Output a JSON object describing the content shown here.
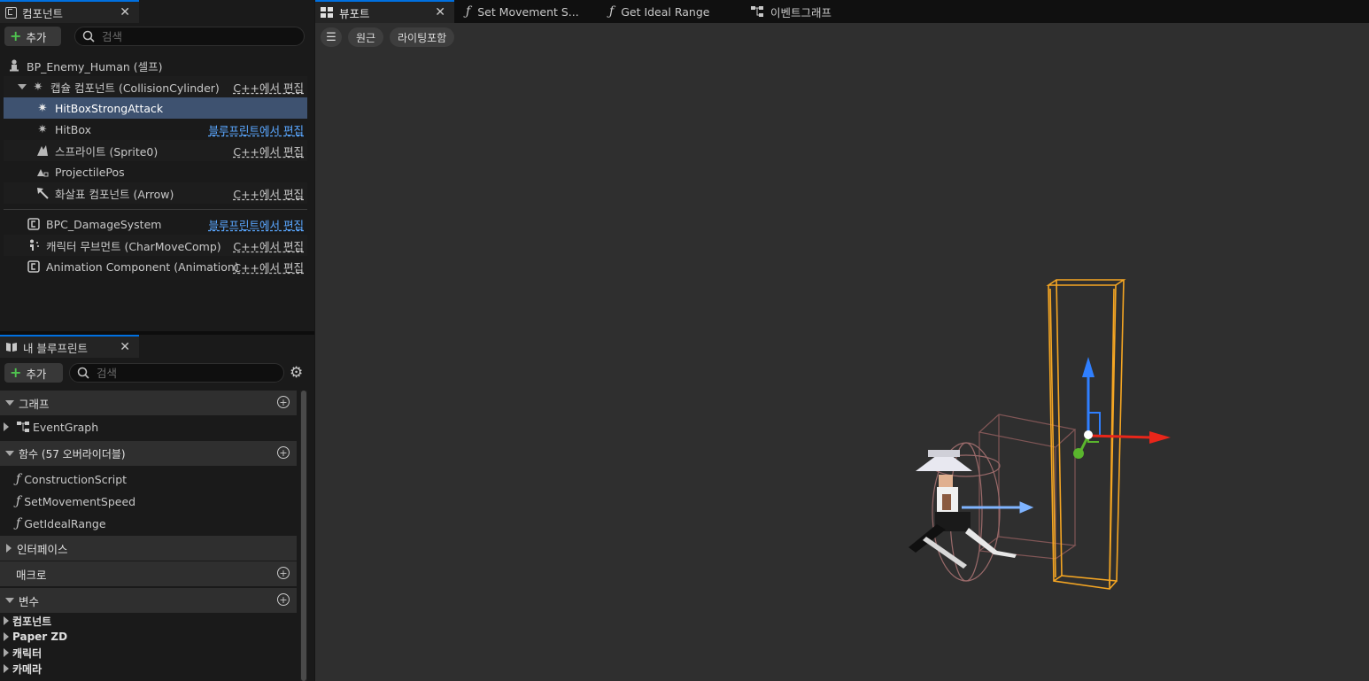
{
  "components_panel": {
    "tab_label": "컴포넌트",
    "add_label": "추가",
    "search_placeholder": "검색",
    "items": [
      {
        "label": "BP_Enemy_Human (셀프)",
        "action": ""
      },
      {
        "label": "캡슐 컴포넌트 (CollisionCylinder)",
        "action": "C++에서 편집"
      },
      {
        "label": "HitBoxStrongAttack",
        "action": ""
      },
      {
        "label": "HitBox",
        "action": "블루프린트에서 편집"
      },
      {
        "label": "스프라이트 (Sprite0)",
        "action": "C++에서 편집"
      },
      {
        "label": "ProjectilePos",
        "action": ""
      },
      {
        "label": "화살표 컴포넌트 (Arrow)",
        "action": "C++에서 편집"
      },
      {
        "label": "BPC_DamageSystem",
        "action": "블루프린트에서 편집"
      },
      {
        "label": "캐릭터 무브먼트 (CharMoveComp)",
        "action": "C++에서 편집"
      },
      {
        "label": "Animation Component (Animation)",
        "action": "C++에서 편집"
      }
    ]
  },
  "blueprint_panel": {
    "tab_label": "내 블루프린트",
    "add_label": "추가",
    "search_placeholder": "검색",
    "sections": {
      "graphs": "그래프",
      "functions": "함수 (57 오버라이더블)",
      "interfaces": "인터페이스",
      "macros": "매크로",
      "variables": "변수"
    },
    "graphs": [
      "EventGraph"
    ],
    "functions": [
      "ConstructionScript",
      "SetMovementSpeed",
      "GetIdealRange"
    ],
    "variable_categories": [
      "컴포넌트",
      "Paper ZD",
      "캐릭터",
      "카메라"
    ]
  },
  "doc_tabs": [
    "뷰포트",
    "Set Movement S...",
    "Get Ideal Range",
    "이벤트그래프"
  ],
  "viewport": {
    "perspective_label": "원근",
    "lighting_label": "라이팅포함"
  },
  "colors": {
    "accent": "#0070e0",
    "selected_row": "#3e5270",
    "link_blue": "#5aa7ff",
    "add_green": "#4fc24f",
    "gizmo_x": "#e8261a",
    "gizmo_y": "#5ab52d",
    "gizmo_z": "#2f7fff",
    "hitbox_orange": "#ffb020"
  }
}
